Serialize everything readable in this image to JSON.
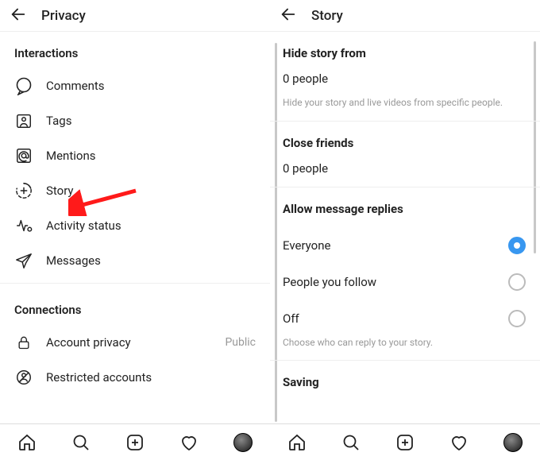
{
  "left": {
    "title": "Privacy",
    "sections": {
      "interactions": {
        "title": "Interactions",
        "items": [
          {
            "label": "Comments"
          },
          {
            "label": "Tags"
          },
          {
            "label": "Mentions"
          },
          {
            "label": "Story"
          },
          {
            "label": "Activity status"
          },
          {
            "label": "Messages"
          }
        ]
      },
      "connections": {
        "title": "Connections",
        "items": [
          {
            "label": "Account privacy",
            "trailing": "Public"
          },
          {
            "label": "Restricted accounts"
          }
        ]
      }
    }
  },
  "right": {
    "title": "Story",
    "hide": {
      "title": "Hide story from",
      "value": "0 people",
      "help": "Hide your story and live videos from specific people."
    },
    "close_friends": {
      "title": "Close friends",
      "value": "0 people"
    },
    "replies": {
      "title": "Allow message replies",
      "options": [
        {
          "label": "Everyone",
          "selected": true
        },
        {
          "label": "People you follow",
          "selected": false
        },
        {
          "label": "Off",
          "selected": false
        }
      ],
      "help": "Choose who can reply to your story."
    },
    "saving": {
      "title": "Saving"
    }
  },
  "nav": {
    "home": "home-icon",
    "search": "search-icon",
    "add": "add-post-icon",
    "activity": "heart-icon",
    "profile": "profile-avatar"
  }
}
